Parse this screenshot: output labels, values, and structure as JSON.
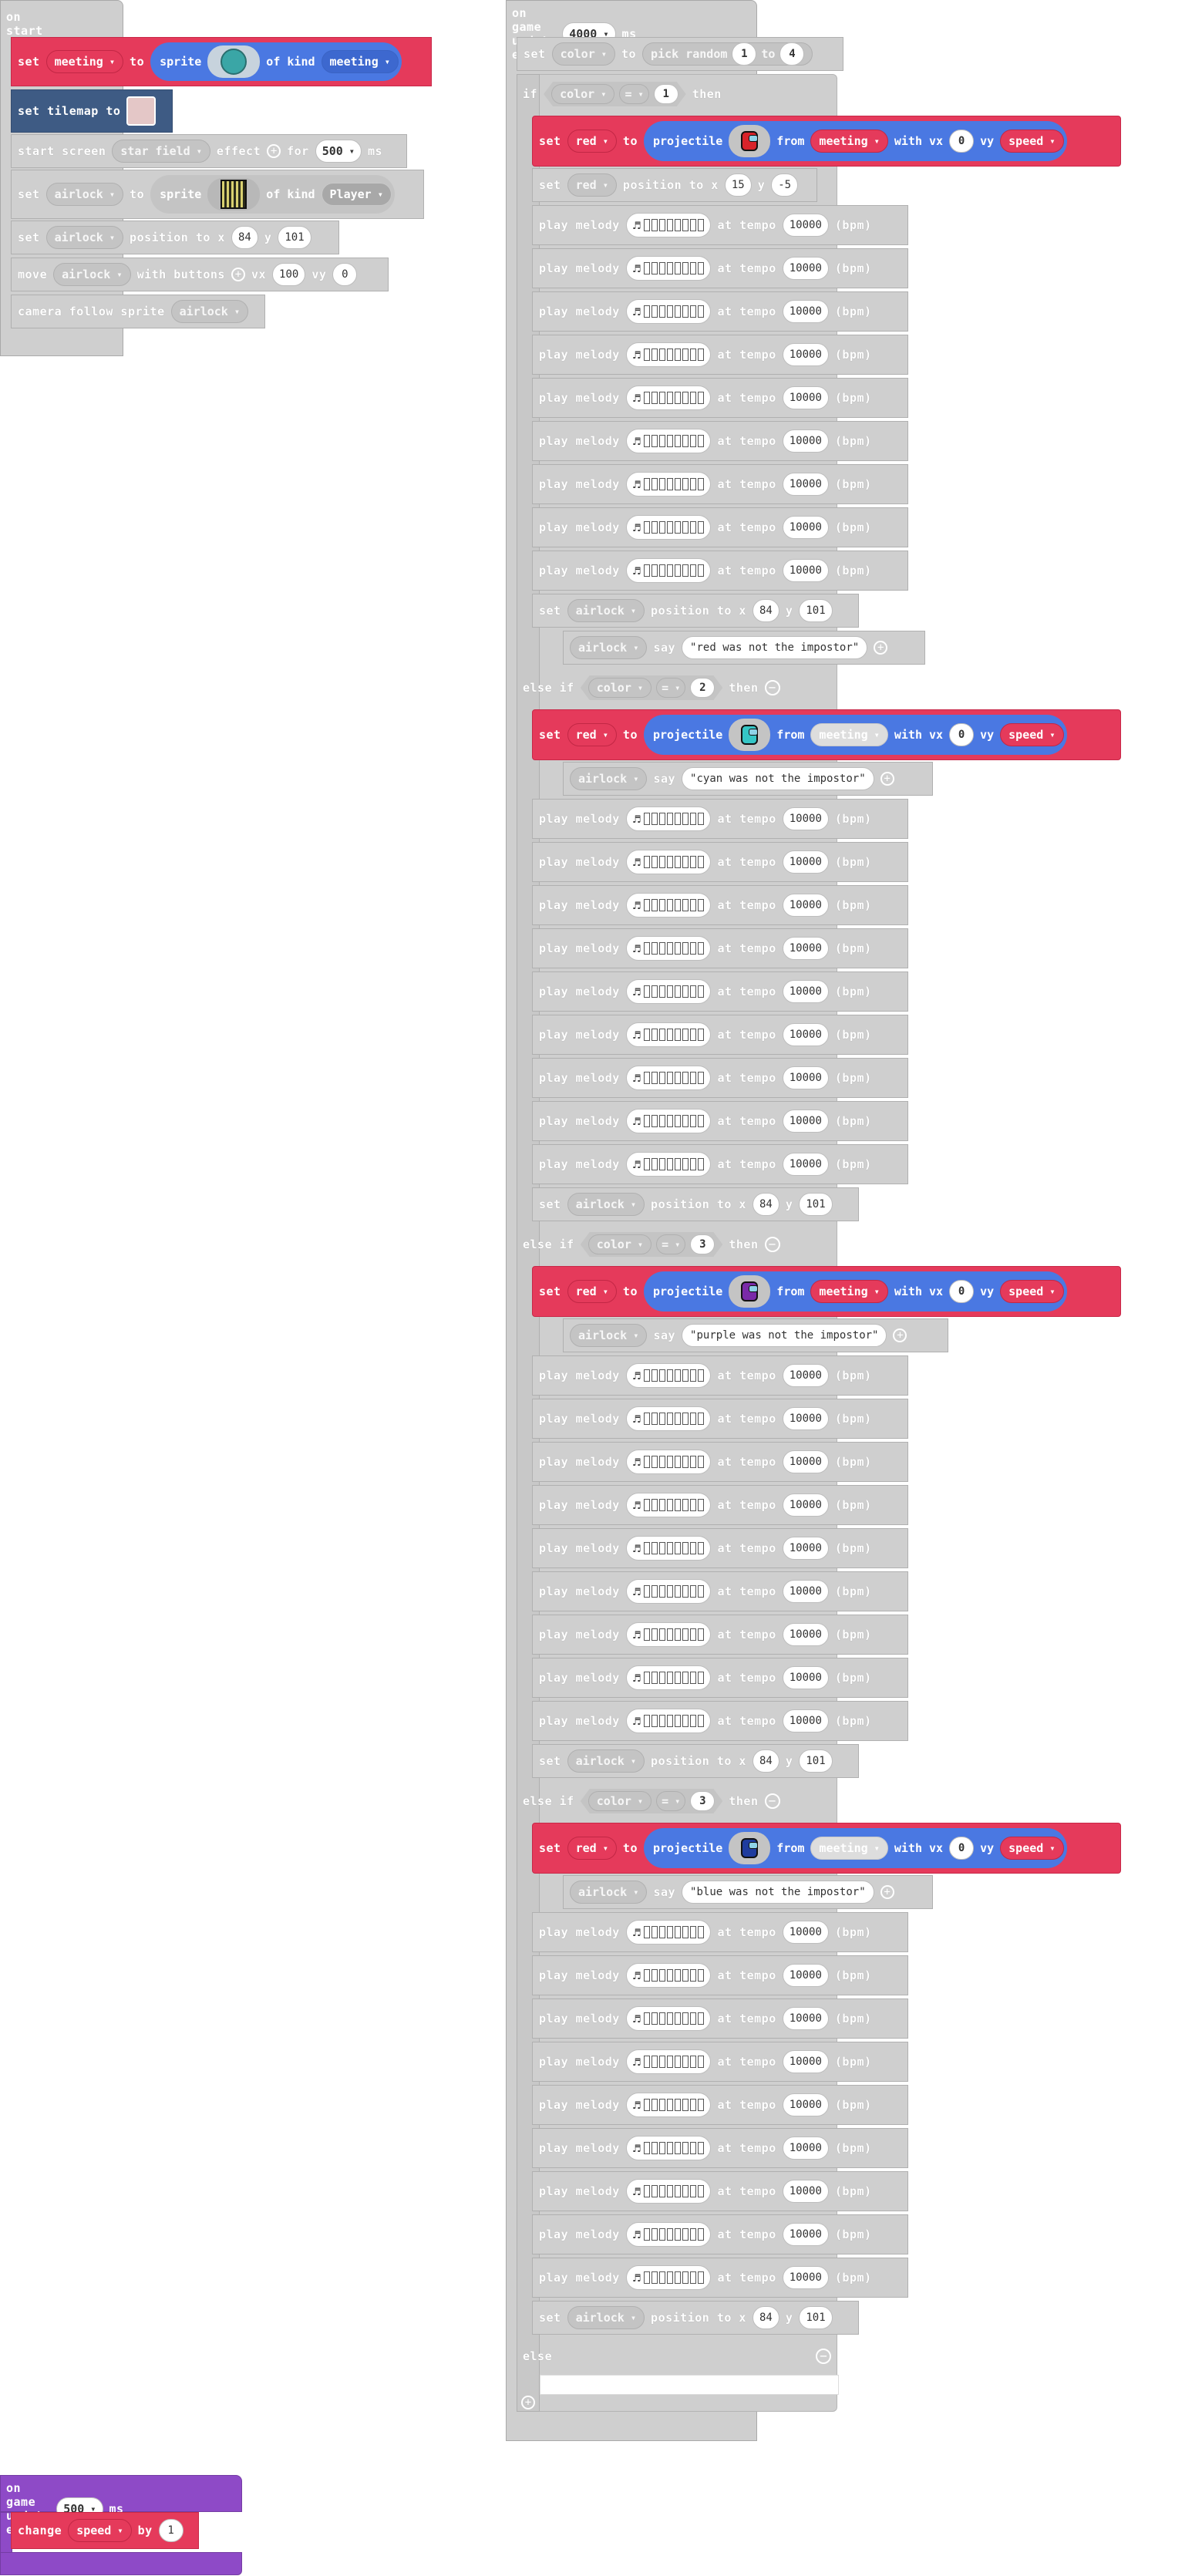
{
  "on_start": {
    "hat_label": "on start",
    "set_meeting": {
      "set": "set",
      "var": "meeting",
      "to": "to",
      "sprite": "sprite",
      "of_kind": "of kind",
      "kind": "meeting"
    },
    "tilemap": {
      "label": "set tilemap to"
    },
    "effect": {
      "label": "start screen",
      "effect": "star field",
      "effect_word": "effect",
      "for": "for",
      "ms_value": "500",
      "ms": "ms"
    },
    "set_airlock": {
      "set": "set",
      "var": "airlock",
      "to": "to",
      "sprite": "sprite",
      "of_kind": "of kind",
      "kind": "Player"
    },
    "position": {
      "set": "set",
      "var": "airlock",
      "label": "position to x",
      "x": "84",
      "y_label": "y",
      "y": "101"
    },
    "move": {
      "label": "move",
      "var": "airlock",
      "with": "with buttons",
      "vx": "vx",
      "vx_val": "100",
      "vy": "vy",
      "vy_val": "0"
    },
    "camera": {
      "label": "camera follow sprite",
      "var": "airlock"
    }
  },
  "game_update_main": {
    "label": "on game update every",
    "interval": "4000",
    "ms": "ms",
    "set_color": {
      "set": "set",
      "var": "color",
      "to": "to",
      "pick": "pick random",
      "from": "1",
      "to2": "to",
      "max": "4"
    },
    "if_word": "if",
    "then_word": "then",
    "else_if_word": "else if",
    "else_word": "else",
    "eq_op": "=",
    "color_var": "color",
    "melody_label": "play melody",
    "at_tempo": "at tempo",
    "tempo": "10000",
    "bpm": "(bpm)",
    "set_word": "set",
    "red_var": "red",
    "projectile_word": "projectile",
    "from_word": "from",
    "with_vx": "with vx",
    "vy_word": "vy",
    "speed_var": "speed",
    "airlock_var": "airlock",
    "say_word": "say",
    "position_label": "position to x",
    "y_word": "y",
    "pos_x": "84",
    "pos_y": "101",
    "red_branch": {
      "cond": "1",
      "from": "meeting",
      "vx": "0",
      "pos2_x": "15",
      "pos2_y": "-5",
      "say": "\"red was not the impostor\""
    },
    "cyan_branch": {
      "cond": "2",
      "from": "meeting",
      "vx": "0",
      "say": "\"cyan was not the impostor\""
    },
    "purple_branch": {
      "cond": "3",
      "from": "meeting",
      "vx": "0",
      "say": "\"purple was not the impostor\""
    },
    "blue_branch": {
      "cond": "3",
      "from": "meeting",
      "vx": "0",
      "say": "\"blue was not the impostor\""
    }
  },
  "game_update_speed": {
    "label": "on game update every",
    "interval": "500",
    "ms": "ms",
    "change": "change",
    "var": "speed",
    "by": "by",
    "value": "1"
  },
  "colors": {
    "red": "#e53a5b",
    "blue": "#4a78e2",
    "gray": "#cfcfcf",
    "purple": "#8e4ac7",
    "tilemap_blue": "#3e5b84"
  }
}
